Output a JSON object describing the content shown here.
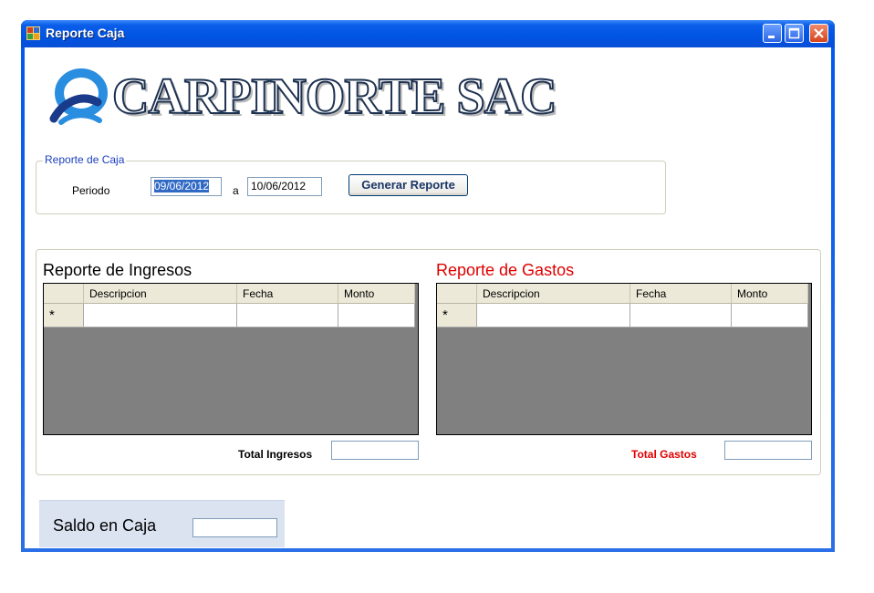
{
  "window": {
    "title": "Reporte Caja"
  },
  "header": {
    "company": "CARPINORTE SAC"
  },
  "periodo": {
    "group_caption": "Reporte de Caja",
    "label": "Periodo",
    "from": "09/06/2012",
    "separator": "a",
    "to": "10/06/2012",
    "button": "Generar Reporte"
  },
  "ingresos": {
    "title": "Reporte de Ingresos",
    "columns": [
      "Descripcion",
      "Fecha",
      "Monto"
    ],
    "new_row_marker": "*",
    "total_label": "Total Ingresos",
    "total_value": ""
  },
  "gastos": {
    "title": "Reporte de Gastos",
    "columns": [
      "Descripcion",
      "Fecha",
      "Monto"
    ],
    "new_row_marker": "*",
    "total_label": "Total Gastos",
    "total_value": "",
    "color": "#e00000"
  },
  "saldo": {
    "label": "Saldo en Caja",
    "value": ""
  }
}
